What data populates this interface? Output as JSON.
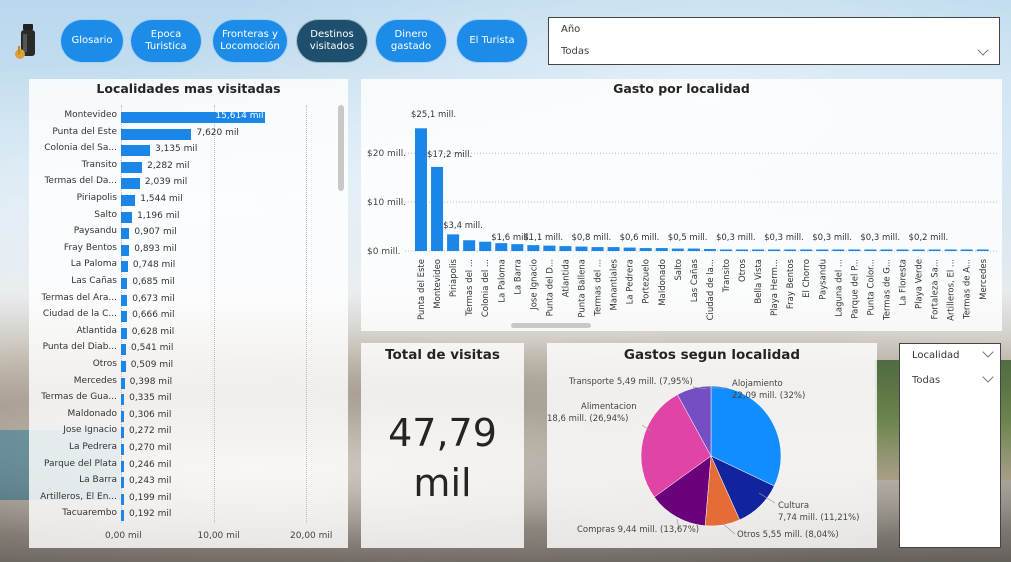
{
  "nav": {
    "buttons": [
      {
        "label": "Glosario",
        "active": false
      },
      {
        "label": "Epoca\nTuristica",
        "active": false
      },
      {
        "label": "Fronteras y\nLocomoción",
        "active": false
      },
      {
        "label": "Destinos\nvisitados",
        "active": true
      },
      {
        "label": "Dinero\ngastado",
        "active": false
      },
      {
        "label": "El Turista",
        "active": false
      }
    ]
  },
  "year_slicer": {
    "label": "Año",
    "value": "Todas"
  },
  "localidad_slicer": {
    "label": "Localidad",
    "value": "Todas"
  },
  "left_chart": {
    "title": "Localidades mas visitadas",
    "x_ticks": [
      "0,00 mil",
      "10,00 mil",
      "20,00 mil"
    ]
  },
  "top_chart": {
    "title": "Gasto por localidad",
    "y_ticks": [
      "$20 mill.",
      "$10 mill.",
      "$0 mill."
    ]
  },
  "total_card": {
    "title": "Total de visitas",
    "value_line1": "47,79",
    "value_line2": "mil"
  },
  "pie_chart": {
    "title": "Gastos segun localidad"
  },
  "colors": {
    "accent": "#1a86e8",
    "nav_active": "#1e4f6f",
    "pie_alojamiento": "#118DFF",
    "pie_cultura": "#12239E",
    "pie_otros": "#E66C37",
    "pie_compras": "#6B007B",
    "pie_alimentacion": "#E044A7",
    "pie_transporte": "#744EC2"
  },
  "chart_data": [
    {
      "type": "bar",
      "orientation": "horizontal",
      "title": "Localidades mas visitadas",
      "xlim": [
        0,
        20000
      ],
      "categories": [
        "Montevideo",
        "Punta del Este",
        "Colonia del Sa...",
        "Transito",
        "Termas del Da...",
        "Piriapolis",
        "Salto",
        "Paysandu",
        "Fray Bentos",
        "La Paloma",
        "Las Cañas",
        "Termas del Ara...",
        "Ciudad de la C...",
        "Atlantida",
        "Punta del Diab...",
        "Otros",
        "Mercedes",
        "Termas de Gua...",
        "Maldonado",
        "Jose Ignacio",
        "La Pedrera",
        "Parque del Plata",
        "La Barra",
        "Artilleros, El En...",
        "Tacuarembo"
      ],
      "values": [
        15614,
        7620,
        3135,
        2282,
        2039,
        1544,
        1196,
        907,
        893,
        748,
        685,
        673,
        666,
        628,
        541,
        509,
        398,
        335,
        306,
        272,
        270,
        246,
        243,
        199,
        192
      ],
      "labels": [
        "15,614 mil",
        "7,620 mil",
        "3,135 mil",
        "2,282 mil",
        "2,039 mil",
        "1,544 mil",
        "1,196 mil",
        "0,907 mil",
        "0,893 mil",
        "0,748 mil",
        "0,685 mil",
        "0,673 mil",
        "0,666 mil",
        "0,628 mil",
        "0,541 mil",
        "0,509 mil",
        "0,398 mil",
        "0,335 mil",
        "0,306 mil",
        "0,272 mil",
        "0,270 mil",
        "0,246 mil",
        "0,243 mil",
        "0,199 mil",
        "0,192 mil"
      ]
    },
    {
      "type": "bar",
      "title": "Gasto por localidad",
      "ylim": [
        0,
        27
      ],
      "categories": [
        "Punta del Este",
        "Montevideo",
        "Piriapolis",
        "Termas del ...",
        "Colonia del ...",
        "La Paloma",
        "La Barra",
        "Jose Ignacio",
        "Punta del D...",
        "Atlantida",
        "Punta Ballena",
        "Termas del ...",
        "Manantiales",
        "La Pedrera",
        "Portezuelo",
        "Maldonado",
        "Salto",
        "Las Cañas",
        "Ciudad de la...",
        "Transito",
        "Otros",
        "Bella Vista",
        "Playa Herm...",
        "Fray Bentos",
        "El Chorro",
        "Paysandu",
        "Laguna del ...",
        "Parque del P...",
        "Punta Color...",
        "Termas de G...",
        "La Floresta",
        "Playa Verde",
        "Fortaleza Sa...",
        "Artilleros, El ...",
        "Termas de A...",
        "Mercedes"
      ],
      "values": [
        25.1,
        17.2,
        3.4,
        2.2,
        1.9,
        1.6,
        1.4,
        1.2,
        1.1,
        1.0,
        0.9,
        0.8,
        0.8,
        0.7,
        0.6,
        0.6,
        0.5,
        0.5,
        0.4,
        0.3,
        0.3,
        0.3,
        0.3,
        0.3,
        0.3,
        0.3,
        0.3,
        0.3,
        0.3,
        0.3,
        0.2,
        0.2,
        0.2,
        0.2,
        0.2,
        0.2
      ],
      "data_labels": [
        "$25,1 mill.",
        "$17,2 mill.",
        "$3,4 mill.",
        "",
        "",
        "$1,6 mill.",
        "",
        "$1,1 mill.",
        "",
        "",
        "$0,8 mill.",
        "",
        "",
        "$0,6 mill.",
        "",
        "",
        "$0,5 mill.",
        "",
        "",
        "$0,3 mill.",
        "",
        "",
        "$0,3 mill.",
        "",
        "",
        "$0,3 mill.",
        "",
        "",
        "$0,3 mill.",
        "",
        "",
        "$0,2 mill.",
        "",
        "",
        "",
        ""
      ]
    },
    {
      "type": "pie",
      "title": "Gastos segun localidad",
      "categories": [
        "Alojamiento",
        "Cultura",
        "Otros",
        "Compras",
        "Alimentacion",
        "Transporte"
      ],
      "values": [
        22.09,
        7.74,
        5.55,
        9.44,
        18.6,
        5.49
      ],
      "percentages": [
        32,
        11.21,
        8.04,
        13.67,
        26.94,
        7.95
      ],
      "labels": [
        "Alojamiento\n22,09 mill. (32%)",
        "Cultura\n7,74 mill. (11,21%)",
        "Otros 5,55 mill. (8,04%)",
        "Compras 9,44 mill. (13,67%)",
        "Alimentacion\n18,6 mill. (26,94%)",
        "Transporte 5,49 mill. (7,95%)"
      ]
    }
  ]
}
